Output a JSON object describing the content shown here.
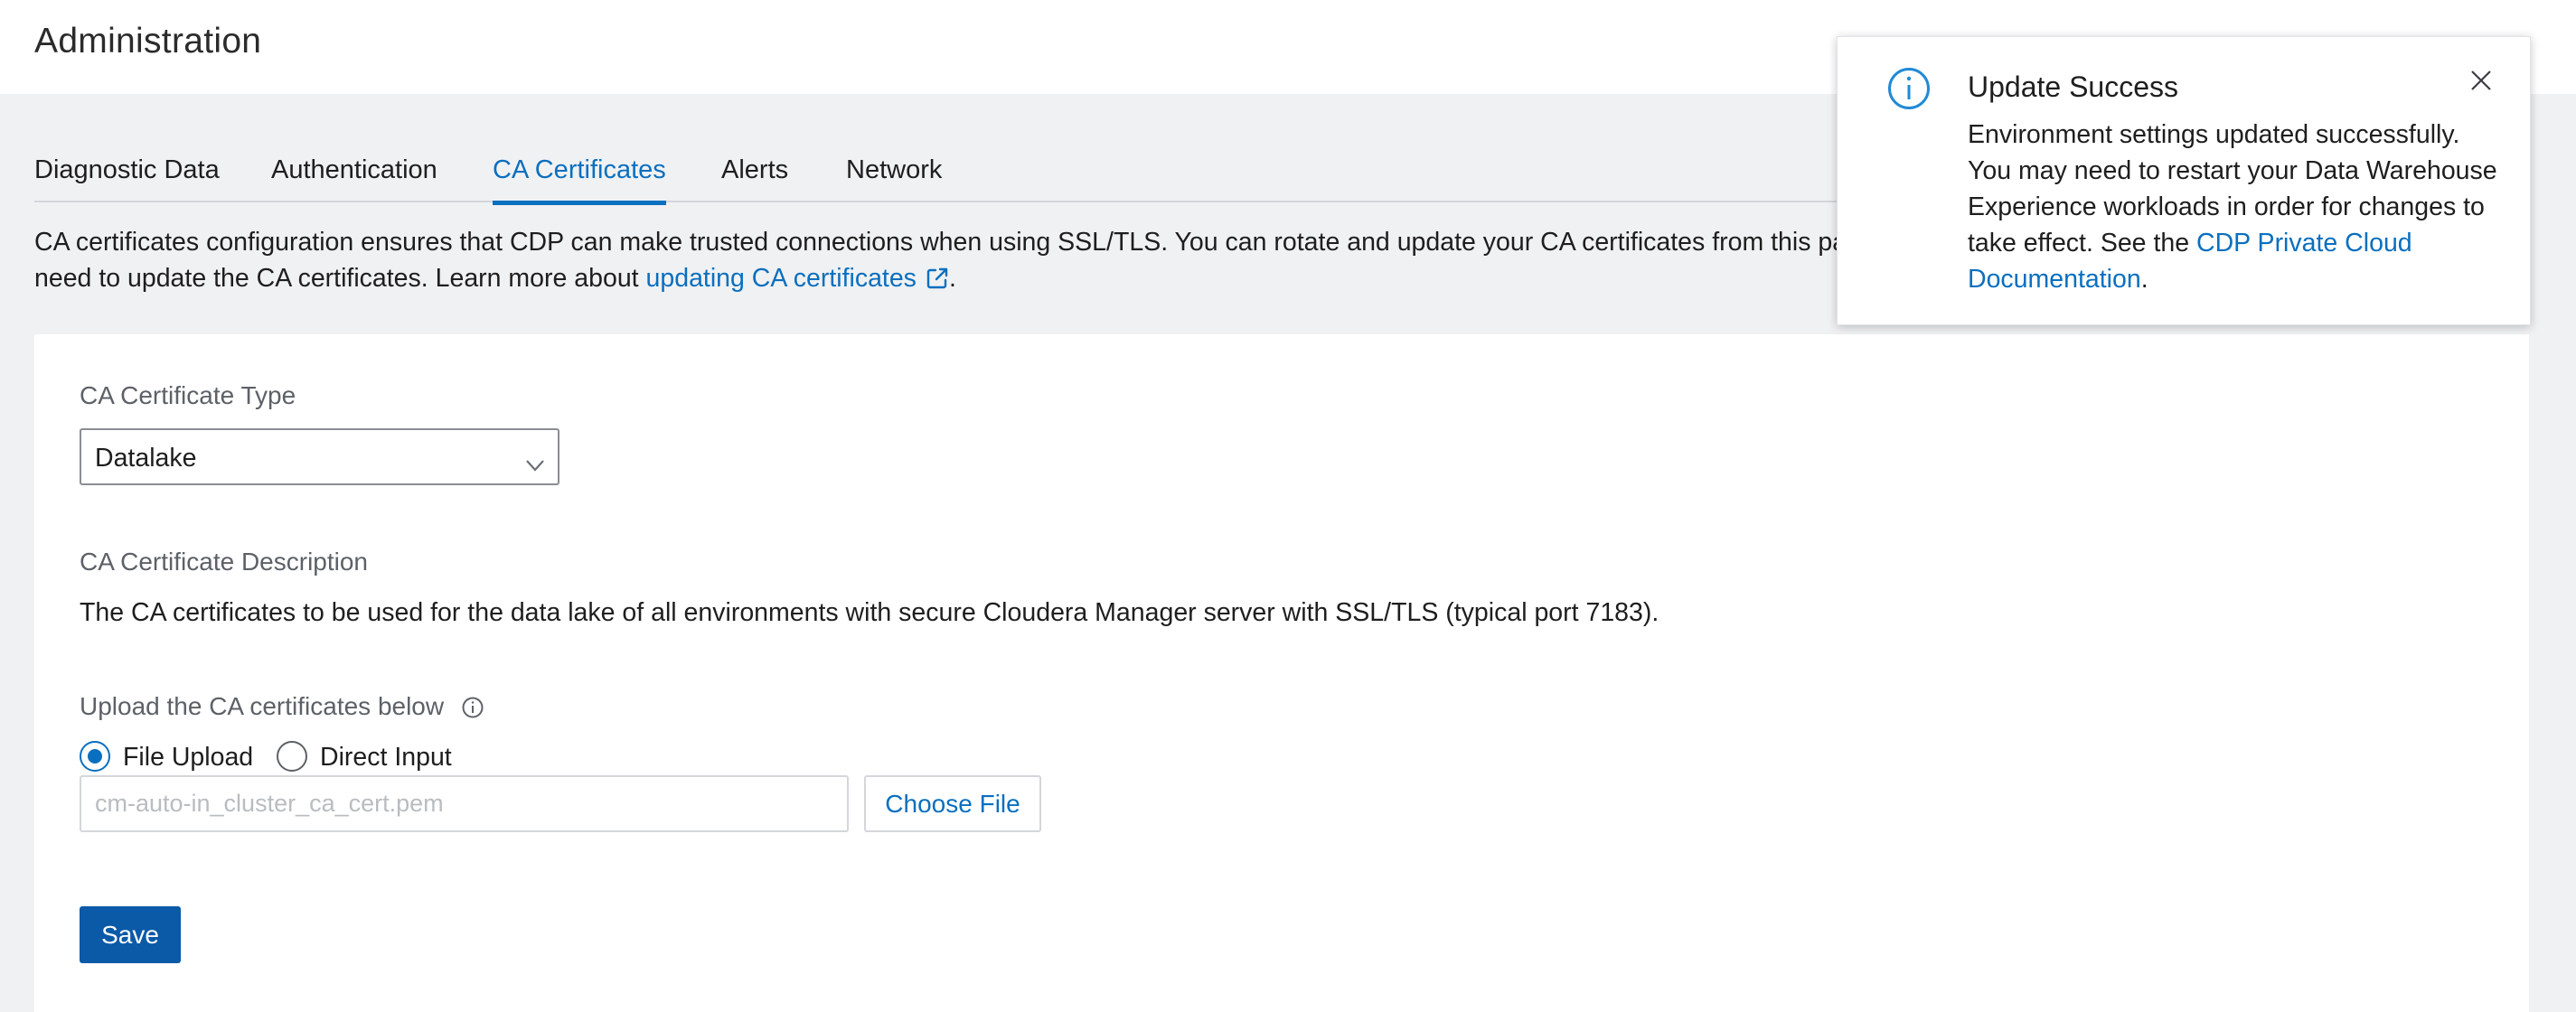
{
  "header": {
    "title": "Administration"
  },
  "tabs": [
    {
      "label": "Diagnostic Data"
    },
    {
      "label": "Authentication"
    },
    {
      "label": "CA Certificates",
      "active": true
    },
    {
      "label": "Alerts"
    },
    {
      "label": "Network"
    }
  ],
  "intro": {
    "text_1": "CA certificates configuration ensures that CDP can make trusted connections when using SSL/TLS. You can rotate and update your CA certificates from this page",
    "text_2": "need to update the CA certificates. Learn more about ",
    "link": "updating CA certificates",
    "text_3": "."
  },
  "form": {
    "type_label": "CA Certificate Type",
    "type_value": "Datalake",
    "description_label": "CA Certificate Description",
    "description_text": "The CA certificates to be used for the data lake of all environments with secure Cloudera Manager server with SSL/TLS (typical port 7183).",
    "upload_label": "Upload the CA certificates below",
    "radio_file_upload": "File Upload",
    "radio_direct_input": "Direct Input",
    "selected_radio": "File Upload",
    "file_placeholder": "cm-auto-in_cluster_ca_cert.pem",
    "choose_file_label": "Choose File",
    "save_label": "Save"
  },
  "toast": {
    "title": "Update Success",
    "body": "Environment settings updated successfully. You may need to restart your Data Warehouse Experience workloads in order for changes to take effect. See the ",
    "link": "CDP Private Cloud Documentation",
    "body_end": "."
  },
  "colors": {
    "accent": "#0a6fbf",
    "primary_button": "#0a5aa8",
    "page_background": "#f0f1f3"
  },
  "icons": {
    "external_link": "external-link-icon",
    "info": "info-icon",
    "close": "close-icon",
    "chevron": "chevron-down-icon"
  }
}
